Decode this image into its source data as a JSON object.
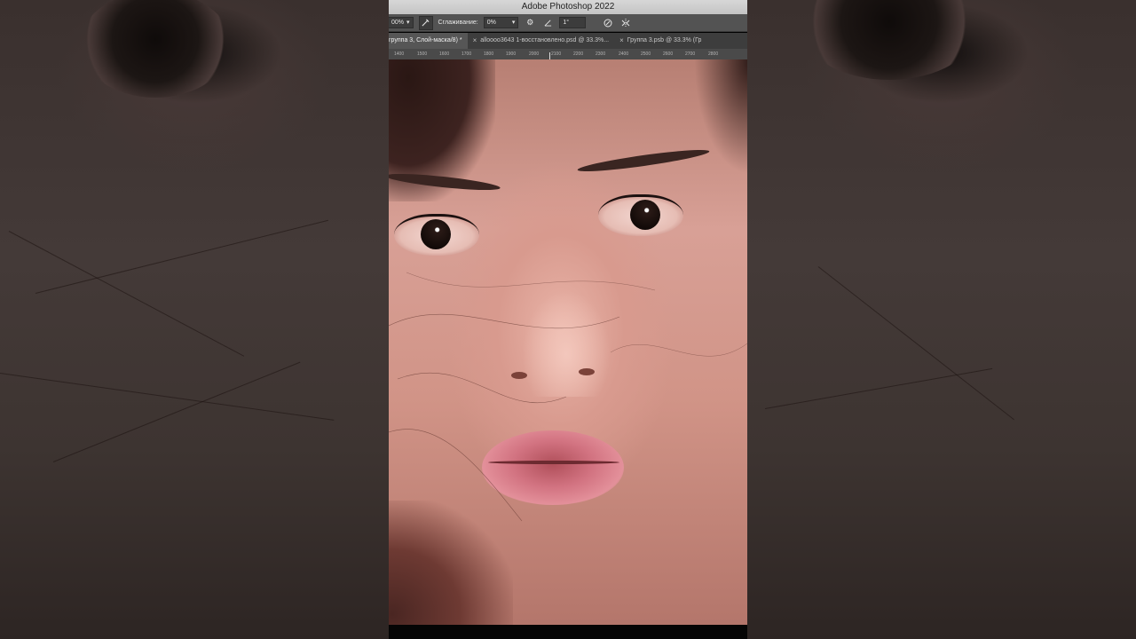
{
  "window": {
    "title": "Adobe Photoshop 2022"
  },
  "options_bar": {
    "opacity_value": "00%",
    "smoothing_label": "Сглаживание:",
    "smoothing_value": "0%",
    "angle_value": "1°",
    "icons": [
      "brush-pressure-icon",
      "settings-gear-icon",
      "angle-icon",
      "pressure-size-icon",
      "symmetry-icon"
    ]
  },
  "tabs": [
    {
      "label": "группа 3, Слой-маска/8) *",
      "active": true
    },
    {
      "label": "alloooo3643 1-восстановлено.psd @ 33.3%...",
      "active": false
    },
    {
      "label": "Группа 3.psb @ 33.3% (Гр",
      "active": false
    }
  ],
  "ruler": {
    "ticks": [
      "1400",
      "1500",
      "1600",
      "1700",
      "1800",
      "1900",
      "2000",
      "2100",
      "2200",
      "2300",
      "2400",
      "2500",
      "2600",
      "2700",
      "2800"
    ]
  },
  "colors": {
    "titlebar": "#c9c9c9",
    "options_bar": "#535353",
    "tab_bar": "#3d3d3d",
    "active_tab": "#565656",
    "ruler": "#4a4a4a",
    "background": "#2a2220"
  }
}
